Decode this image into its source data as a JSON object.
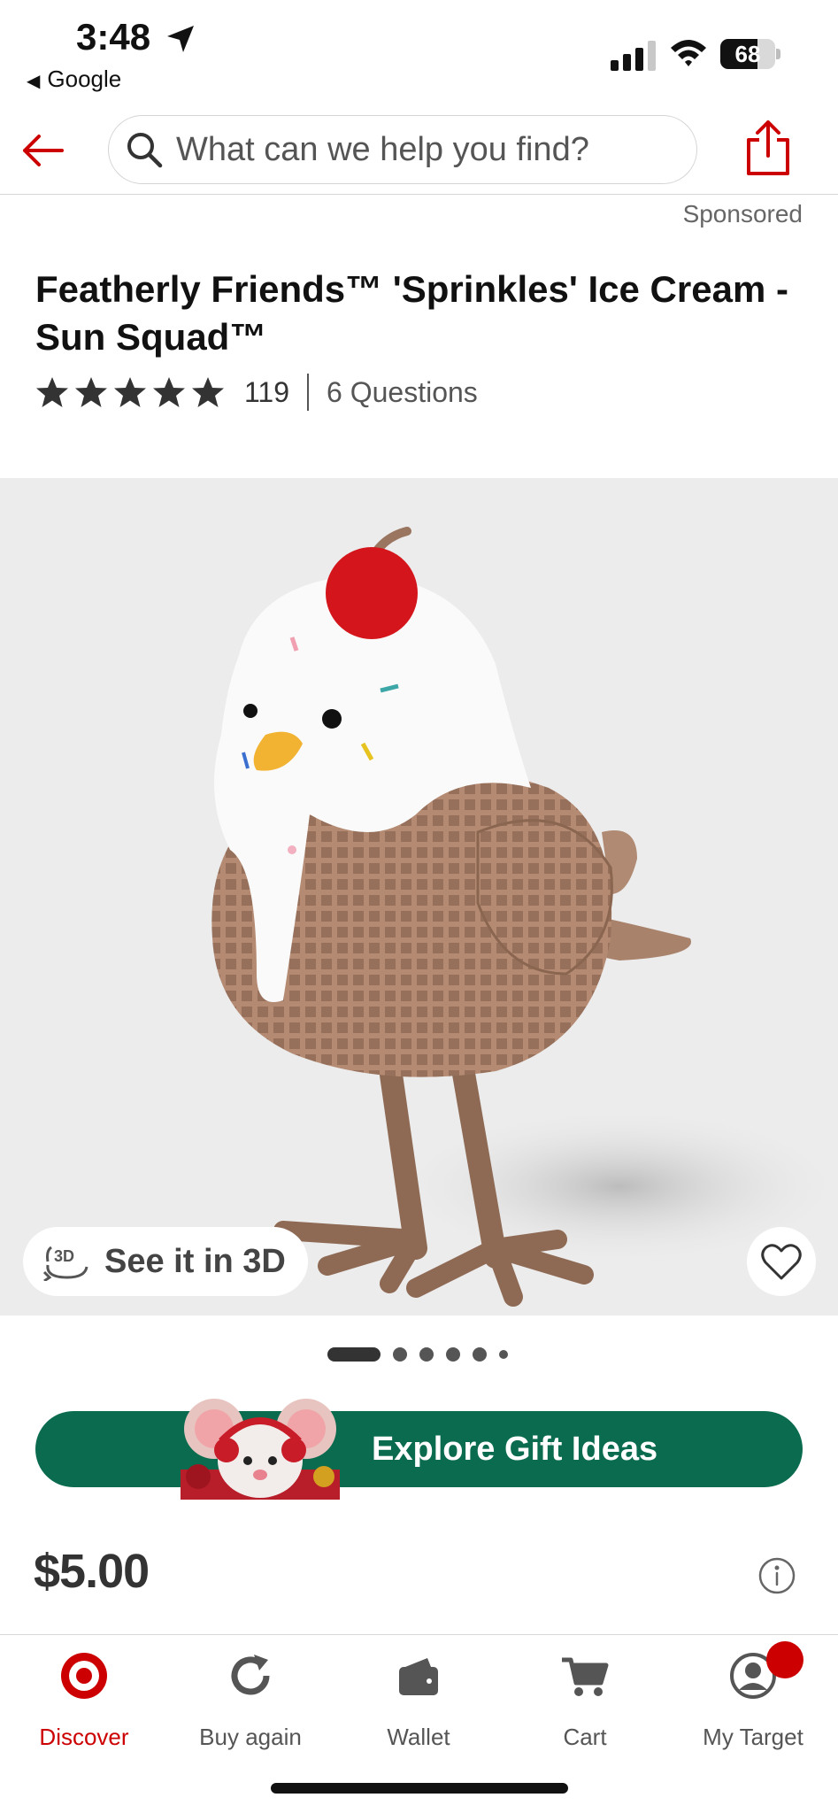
{
  "status_bar": {
    "time": "3:48",
    "back_app": "Google",
    "battery": "68",
    "battery_level": 0.68
  },
  "header": {
    "search_placeholder": "What can we help you find?"
  },
  "sponsored": "Sponsored",
  "product": {
    "title": "Featherly Friends™ 'Sprinkles' Ice Cream - Sun Squad™",
    "rating_stars": 5,
    "review_count": "119",
    "questions": "6 Questions",
    "see_3d_label": "See it in 3D",
    "carousel_total": 6,
    "carousel_active": 0,
    "price": "$5.00"
  },
  "promo": {
    "explore_label": "Explore Gift Ideas"
  },
  "colors": {
    "brand_red": "#cc0000",
    "promo_green": "#0b6b4f",
    "image_bg": "#ececec"
  },
  "bottom_nav": {
    "items": [
      {
        "label": "Discover",
        "icon": "target-logo-icon",
        "active": true
      },
      {
        "label": "Buy again",
        "icon": "refresh-icon",
        "active": false
      },
      {
        "label": "Wallet",
        "icon": "wallet-icon",
        "active": false
      },
      {
        "label": "Cart",
        "icon": "cart-icon",
        "active": false
      },
      {
        "label": "My Target",
        "icon": "account-icon",
        "active": false
      }
    ]
  }
}
